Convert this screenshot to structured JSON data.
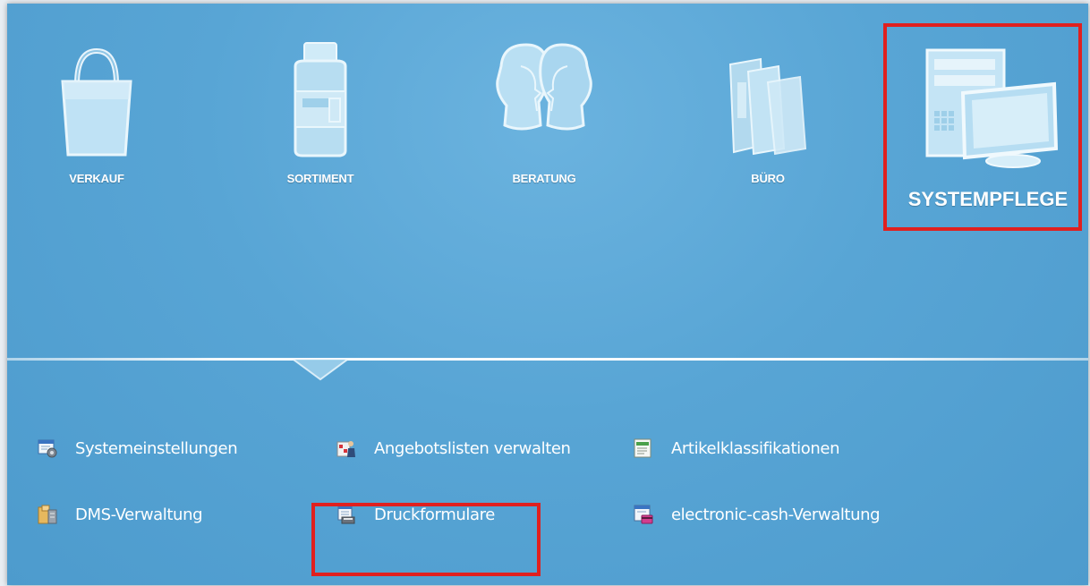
{
  "modules": [
    {
      "label": "VERKAUF",
      "icon": "shopping-bag-icon"
    },
    {
      "label": "SORTIMENT",
      "icon": "medicine-jar-icon"
    },
    {
      "label": "BERATUNG",
      "icon": "consultation-heads-icon"
    },
    {
      "label": "BÜRO",
      "icon": "office-folders-icon"
    },
    {
      "label": "SYSTEMPFLEGE",
      "icon": "computer-workstation-icon",
      "selected": true
    }
  ],
  "submenu": [
    {
      "label": "Systemeinstellungen",
      "icon": "system-settings-icon"
    },
    {
      "label": "Angebotslisten verwalten",
      "icon": "offer-lists-icon"
    },
    {
      "label": "Artikelklassifikationen",
      "icon": "article-classification-icon"
    },
    {
      "label": "DMS-Verwaltung",
      "icon": "dms-archive-icon"
    },
    {
      "label": "Druckformulare",
      "icon": "print-forms-icon",
      "highlighted": true
    },
    {
      "label": "electronic-cash-Verwaltung",
      "icon": "ec-card-icon"
    }
  ],
  "colors": {
    "background": "#58a5d5",
    "highlight": "#e0201f",
    "text": "#ffffff"
  }
}
